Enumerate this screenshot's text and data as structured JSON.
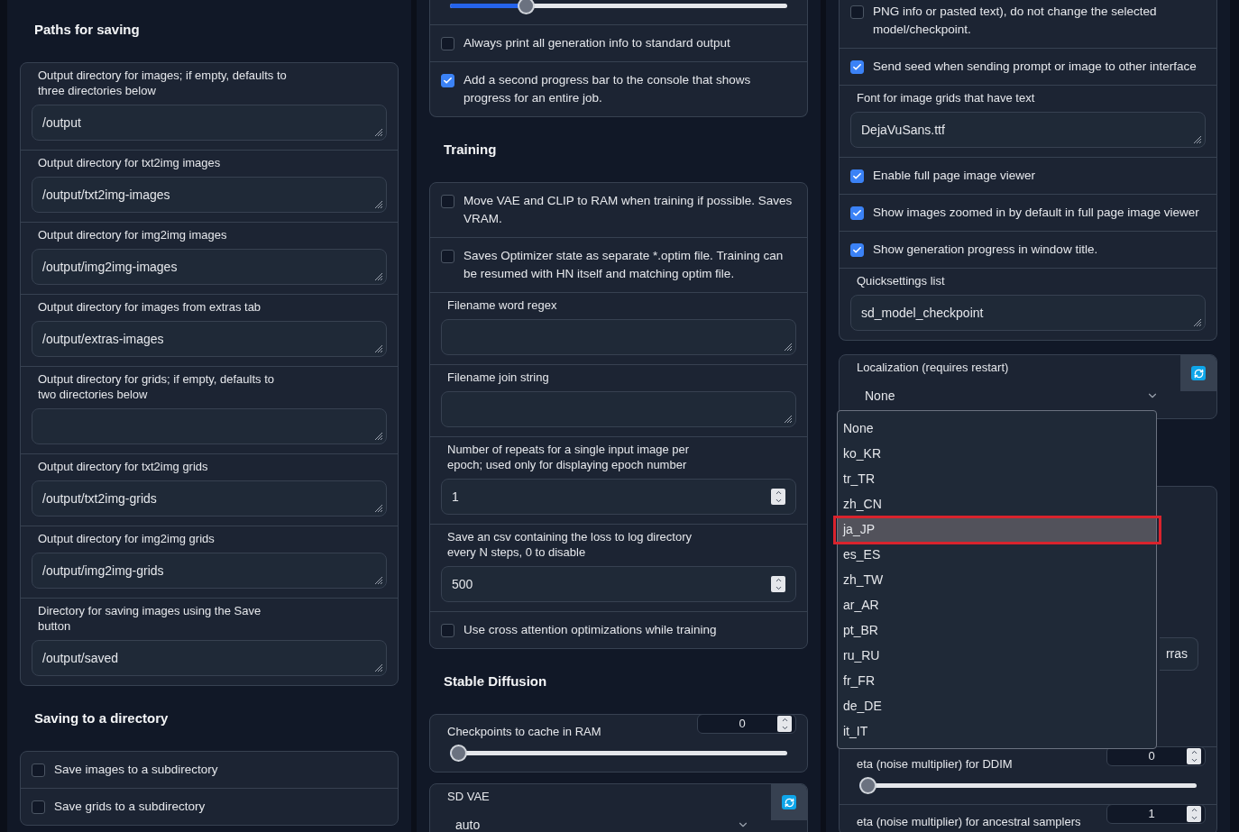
{
  "left": [
    {
      "kind": "heading",
      "text": "Paths for saving"
    },
    {
      "kind": "panel",
      "rows": [
        {
          "kind": "textbox",
          "label": "Output directory for images; if empty, defaults to three directories below",
          "value": "/output"
        },
        {
          "kind": "textbox",
          "label": "Output directory for txt2img images",
          "value": "/output/txt2img-images"
        },
        {
          "kind": "textbox",
          "label": "Output directory for img2img images",
          "value": "/output/img2img-images"
        },
        {
          "kind": "textbox",
          "label": "Output directory for images from extras tab",
          "value": "/output/extras-images"
        },
        {
          "kind": "textbox",
          "label": "Output directory for grids; if empty, defaults to two directories below"
        },
        {
          "kind": "textbox",
          "label": "Output directory for txt2img grids",
          "value": "/output/txt2img-grids"
        },
        {
          "kind": "textbox",
          "label": "Output directory for img2img grids",
          "value": "/output/img2img-grids"
        },
        {
          "kind": "textbox",
          "label": "Directory for saving images using the Save button",
          "value": "/output/saved"
        }
      ]
    },
    {
      "kind": "heading",
      "text": "Saving to a directory"
    },
    {
      "kind": "panel",
      "rows": [
        {
          "kind": "checkbox",
          "label": "Save images to a subdirectory",
          "checked": false
        },
        {
          "kind": "checkbox",
          "label": "Save grids to a subdirectory",
          "checked": false
        }
      ]
    }
  ],
  "middle": [
    {
      "kind": "panel",
      "rows": [
        {
          "kind": "slider",
          "level": 0.21
        },
        {
          "kind": "checkbox",
          "label": "Always print all generation info to standard output",
          "checked": false
        },
        {
          "kind": "checkbox",
          "label": "Add a second progress bar to the console that shows progress for an entire job.",
          "checked": true
        }
      ]
    },
    {
      "kind": "heading",
      "text": "Training"
    },
    {
      "kind": "panel",
      "rows": [
        {
          "kind": "checkbox",
          "label": "Move VAE and CLIP to RAM when training if possible. Saves VRAM.",
          "checked": false
        },
        {
          "kind": "checkbox",
          "label": "Saves Optimizer state as separate *.optim file. Training can be resumed with HN itself and matching optim file.",
          "checked": false
        },
        {
          "kind": "textbox",
          "label": "Filename word regex"
        },
        {
          "kind": "textbox",
          "label": "Filename join string"
        },
        {
          "kind": "number",
          "label": "Number of repeats for a single input image per epoch; used only for displaying epoch number",
          "value": "1"
        },
        {
          "kind": "number",
          "label": "Save an csv containing the loss to log directory every N steps, 0 to disable",
          "value": "500"
        },
        {
          "kind": "checkbox",
          "label": "Use cross attention optimizations while training",
          "checked": false
        }
      ]
    },
    {
      "kind": "heading",
      "text": "Stable Diffusion"
    },
    {
      "kind": "panel",
      "rows": [
        {
          "kind": "slider",
          "label": "Checkpoints to cache in RAM",
          "value": "0",
          "level": 0
        }
      ]
    },
    {
      "kind": "panel",
      "rows": [
        {
          "kind": "dropdown",
          "label": "SD VAE",
          "value": "auto",
          "refresh": true
        }
      ]
    }
  ],
  "right": [
    {
      "kind": "panel",
      "rows": [
        {
          "kind": "checkbox",
          "label": "PNG info or pasted text), do not change the selected model/checkpoint.",
          "checked": false
        },
        {
          "kind": "checkbox",
          "label": "Send seed when sending prompt or image to other interface",
          "checked": true
        },
        {
          "kind": "textbox",
          "label": "Font for image grids that have text",
          "value": "DejaVuSans.ttf"
        },
        {
          "kind": "checkbox",
          "label": "Enable full page image viewer",
          "checked": true
        },
        {
          "kind": "checkbox",
          "label": "Show images zoomed in by default in full page image viewer",
          "checked": true
        },
        {
          "kind": "checkbox",
          "label": "Show generation progress in window title.",
          "checked": true
        },
        {
          "kind": "textbox",
          "label": "Quicksettings list",
          "value": "sd_model_checkpoint"
        }
      ]
    },
    {
      "kind": "panel",
      "rows": [
        {
          "kind": "dropdown",
          "label": "Localization (requires restart)",
          "value": "None",
          "refresh": true,
          "options": [
            {
              "label": "None",
              "highlighted": false
            },
            {
              "label": "ko_KR",
              "highlighted": false
            },
            {
              "label": "tr_TR",
              "highlighted": false
            },
            {
              "label": "zh_CN",
              "highlighted": false
            },
            {
              "label": "ja_JP",
              "highlighted": true
            },
            {
              "label": "es_ES",
              "highlighted": false
            },
            {
              "label": "zh_TW",
              "highlighted": false
            },
            {
              "label": "ar_AR",
              "highlighted": false
            },
            {
              "label": "pt_BR",
              "highlighted": false
            },
            {
              "label": "ru_RU",
              "highlighted": false
            },
            {
              "label": "fr_FR",
              "highlighted": false
            },
            {
              "label": "de_DE",
              "highlighted": false
            },
            {
              "label": "it_IT",
              "highlighted": false
            }
          ]
        }
      ]
    },
    {
      "kind": "panel",
      "rows": [
        {
          "kind": "button",
          "label": "rras"
        },
        {
          "kind": "slider",
          "label": "eta (noise multiplier) for DDIM",
          "value": "0",
          "level": 0
        },
        {
          "kind": "slider",
          "label": "eta (noise multiplier) for ancestral samplers",
          "value": "1"
        }
      ]
    }
  ]
}
